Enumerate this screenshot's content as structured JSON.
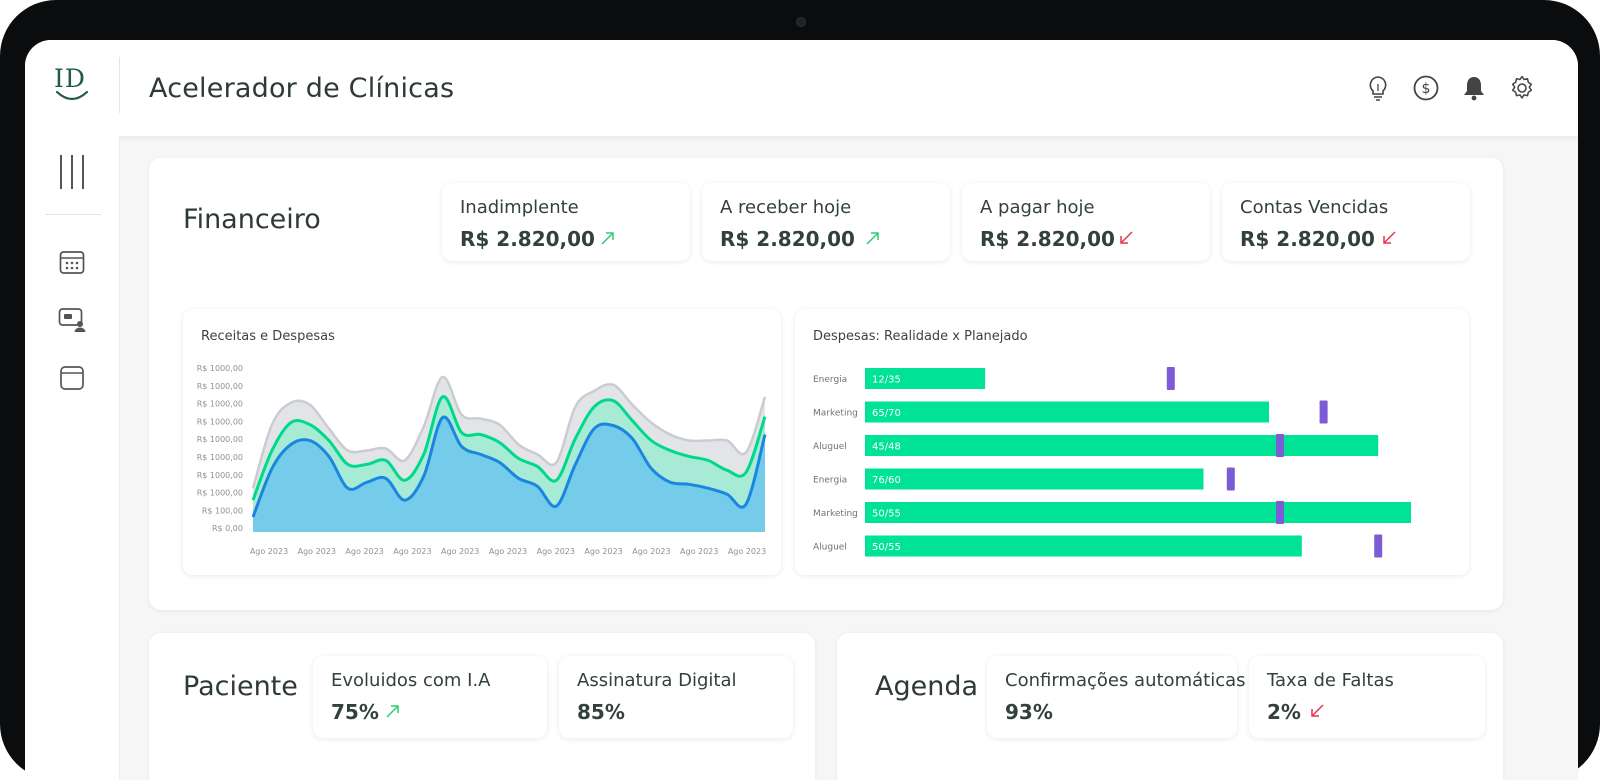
{
  "app": {
    "title": "Acelerador de Clínicas",
    "logo_text": "ID"
  },
  "header_icons": [
    "lightbulb-icon",
    "dollar-circle-icon",
    "bell-icon",
    "gear-icon"
  ],
  "sidebar": {
    "items": [
      "menu-icon",
      "calendar-icon",
      "patient-screen-icon",
      "document-icon"
    ]
  },
  "colors": {
    "up": "#2ecc71",
    "down": "#e8344c",
    "bar": "#00e295",
    "marker": "#7b5bd6",
    "area_blue": "#74cbea",
    "line_blue": "#1b86e0",
    "area_green": "#a7ebd6",
    "line_green": "#00d98a",
    "area_gray": "#e2e4e7"
  },
  "financeiro": {
    "title": "Financeiro",
    "kpis": [
      {
        "label": "Inadimplente",
        "value": "R$ 2.820,00",
        "trend": "up"
      },
      {
        "label": "A receber hoje",
        "value": "R$ 2.820,00",
        "trend": "up"
      },
      {
        "label": "A pagar hoje",
        "value": "R$ 2.820,00",
        "trend": "down"
      },
      {
        "label": "Contas Vencidas",
        "value": "R$ 2.820,00",
        "trend": "down"
      }
    ]
  },
  "paciente": {
    "title": "Paciente",
    "kpis": [
      {
        "label": "Evoluidos com I.A",
        "value": "75%",
        "trend": "up"
      },
      {
        "label": "Assinatura Digital",
        "value": "85%",
        "trend": "none"
      }
    ]
  },
  "agenda": {
    "title": "Agenda",
    "kpis": [
      {
        "label": "Confirmações automáticas",
        "value": "93%",
        "trend": "none"
      },
      {
        "label": "Taxa de Faltas",
        "value": "2%",
        "trend": "down"
      }
    ]
  },
  "chart_data": [
    {
      "type": "area",
      "title": "Receitas e Despesas",
      "y_ticks": [
        "R$ 1000,00",
        "R$ 1000,00",
        "R$ 1000,00",
        "R$ 1000,00",
        "R$ 1000,00",
        "R$ 1000,00",
        "R$ 1000,00",
        "R$ 1000,00",
        "R$ 100,00",
        "R$ 0,00"
      ],
      "x_ticks": [
        "Ago 2023",
        "Ago 2023",
        "Ago 2023",
        "Ago 2023",
        "Ago 2023",
        "Ago 2023",
        "Ago 2023",
        "Ago 2023",
        "Ago 2023",
        "Ago 2023",
        "Ago 2023"
      ],
      "x": [
        0,
        0.4,
        0.8,
        1.2,
        1.6,
        2.0,
        2.4,
        2.8,
        3.2,
        3.6,
        4.0,
        4.4,
        4.8,
        5.2,
        5.6,
        6.0,
        6.4,
        6.8,
        7.2,
        7.6,
        8.0,
        8.4,
        8.8,
        9.2,
        9.6,
        10.0,
        10.4,
        10.8
      ],
      "series": [
        {
          "values": [
            0.75,
            3.2,
            4.4,
            4.6,
            3.8,
            2.2,
            2.5,
            2.7,
            1.6,
            2.8,
            5.75,
            4.3,
            3.9,
            3.5,
            2.7,
            2.3,
            1.3,
            3.4,
            5.2,
            5.35,
            4.7,
            3.2,
            2.5,
            2.4,
            2.2,
            1.9,
            1.4,
            4.9
          ]
        },
        {
          "values": [
            1.6,
            4.1,
            5.5,
            5.4,
            4.6,
            3.4,
            3.4,
            3.6,
            2.6,
            3.9,
            6.8,
            5.0,
            4.9,
            4.5,
            3.7,
            3.3,
            2.6,
            4.7,
            6.3,
            6.6,
            5.6,
            4.6,
            4.1,
            3.8,
            3.6,
            3.1,
            3.0,
            5.8
          ]
        },
        {
          "values": [
            2.2,
            5.4,
            6.5,
            6.4,
            5.2,
            4.1,
            4.1,
            4.2,
            3.6,
            5.3,
            7.8,
            5.9,
            5.7,
            5.4,
            4.4,
            3.9,
            3.5,
            6.3,
            7.1,
            7.4,
            6.4,
            5.5,
            4.9,
            4.6,
            4.6,
            4.6,
            4.0,
            6.8
          ]
        }
      ],
      "ylim": [
        0,
        9
      ]
    },
    {
      "type": "bar",
      "title": "Despesas: Realidade x Planejado",
      "categories": [
        "Energia",
        "Marketing",
        "Aluguel",
        "Energia",
        "Marketing",
        "Aluguel"
      ],
      "values": [
        0.22,
        0.74,
        0.94,
        0.62,
        1.0,
        0.8
      ],
      "targets": [
        0.56,
        0.84,
        0.76,
        0.67,
        0.76,
        0.94
      ],
      "value_labels": [
        "12/35",
        "65/70",
        "45/48",
        "76/60",
        "50/55",
        "50/55"
      ]
    }
  ]
}
